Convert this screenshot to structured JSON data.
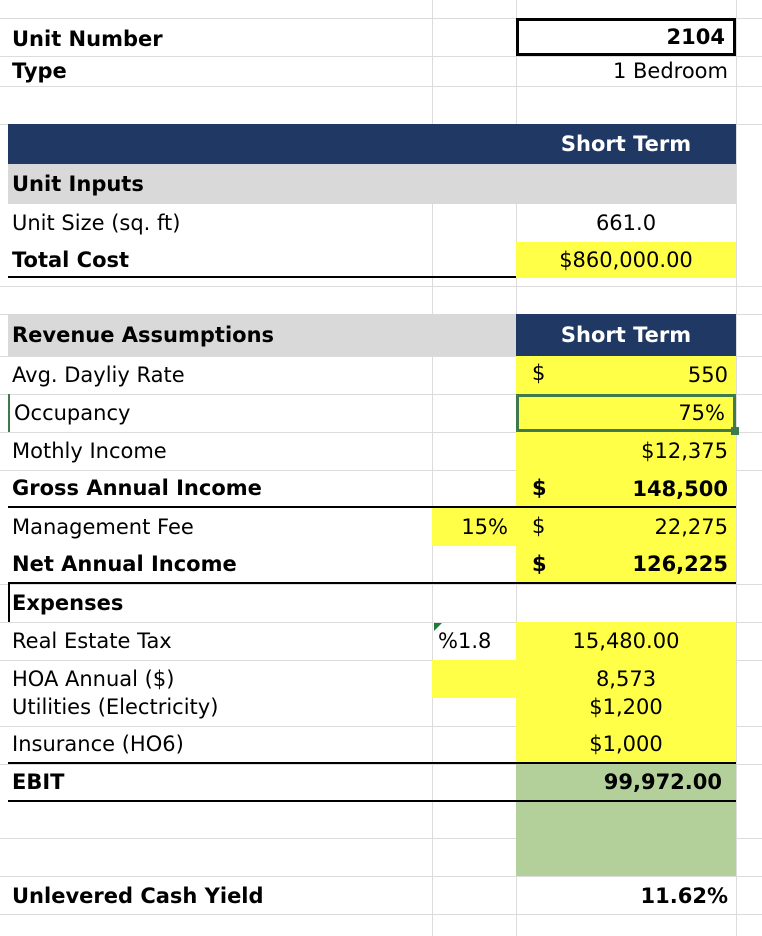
{
  "header": {
    "unit_number_label": "Unit Number",
    "unit_number_value": "2104",
    "type_label": "Type",
    "type_value": "1 Bedroom"
  },
  "section_header_1": "Short Term",
  "unit_inputs": {
    "title": "Unit Inputs",
    "unit_size_label": "Unit Size (sq. ft)",
    "unit_size_value": "661.0",
    "total_cost_label": "Total Cost",
    "total_cost_value": "$860,000.00"
  },
  "revenue": {
    "title": "Revenue Assumptions",
    "column_header": "Short Term",
    "daily_rate_label": "Avg. Dayliy Rate",
    "daily_rate_currency": "$",
    "daily_rate_value": "550",
    "occupancy_label": "Occupancy",
    "occupancy_value": "75%",
    "monthly_income_label": "Mothly Income",
    "monthly_income_value": "$12,375",
    "gross_annual_label": "Gross Annual Income",
    "gross_annual_currency": "$",
    "gross_annual_value": "148,500",
    "mgmt_fee_label": "Management Fee",
    "mgmt_fee_pct": "15%",
    "mgmt_fee_currency": "$",
    "mgmt_fee_value": "22,275",
    "net_annual_label": "Net Annual Income",
    "net_annual_currency": "$",
    "net_annual_value": "126,225"
  },
  "expenses": {
    "title": "Expenses",
    "real_estate_tax_label": "Real Estate Tax",
    "real_estate_tax_pct": "%1.8",
    "real_estate_tax_value": "15,480.00",
    "hoa_label": "HOA Annual ($)",
    "hoa_value": "8,573",
    "utilities_label": "Utilities (Electricity)",
    "utilities_value": "$1,200",
    "insurance_label": "Insurance (HO6)",
    "insurance_value": "$1,000",
    "ebit_label": "EBIT",
    "ebit_value": "99,972.00"
  },
  "yield": {
    "label": "Unlevered Cash Yield",
    "value": "11.62%"
  },
  "colors": {
    "navy": "#1f3864",
    "yellow": "#ffff47",
    "gray": "#d9d9d9",
    "green": "#b4d09a",
    "selected_border": "#3f7a4f"
  }
}
